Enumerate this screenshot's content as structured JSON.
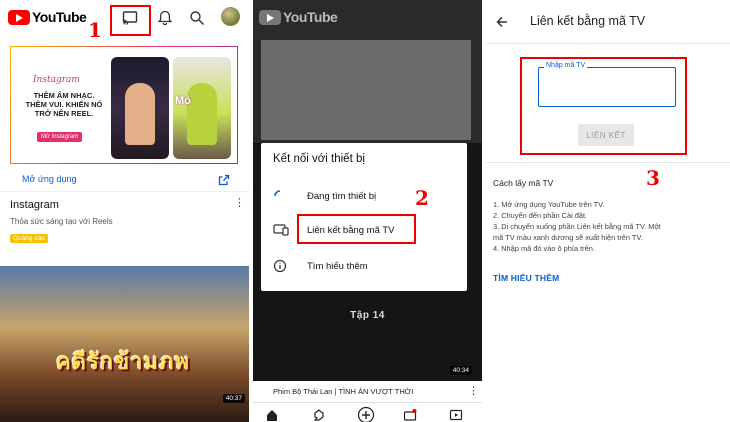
{
  "panel1": {
    "logo_text": "YouTube",
    "annotation": "1",
    "ad": {
      "brand": "Instagram",
      "copy": "THÊM ÂM NHẠC. THÊM VUI. KHIẾN NÓ TRỞ NÊN REEL.",
      "cta": "Mở Instagram",
      "overlay_word": "Mỏ",
      "open_app": "Mở ứng dụng",
      "title": "Instagram",
      "subtitle": "Thỏa sức sáng tạo với Reels",
      "badge": "Quảng cáo"
    },
    "video": {
      "title_art": "คดีรักข้ามภพ",
      "duration": "40:37"
    }
  },
  "panel2": {
    "logo_text": "YouTube",
    "annotation": "2",
    "dialog": {
      "title": "Kết nối với thiết bị",
      "items": [
        "Đang tìm thiết bị",
        "Liên kết bằng mã TV",
        "Tìm hiểu thêm"
      ]
    },
    "episode": "Tập 14",
    "duration": "40:34",
    "video_title": "Phim Bộ Thái Lan | TÌNH ÁN VƯỢT THỜI"
  },
  "panel3": {
    "title": "Liên kết bằng mã TV",
    "input_label": "Nhập mã TV",
    "input_value": "",
    "button": "LIÊN KẾT",
    "annotation": "3",
    "howto_title": "Cách lấy mã TV",
    "steps": [
      "1. Mở ứng dụng YouTube trên TV.",
      "2. Chuyển đến phần Cài đặt.",
      "3. Di chuyển xuống phần Liên kết bằng mã TV. Một",
      "mã TV màu xanh dương sẽ xuất hiện trên TV.",
      "4. Nhập mã đó vào ô phía trên."
    ],
    "learn_more": "TÌM HIỂU THÊM"
  },
  "colors": {
    "youtube_red": "#ff0000",
    "link_blue": "#065fd4",
    "annotation_red": "#e00000",
    "ad_badge": "#f3c200"
  }
}
